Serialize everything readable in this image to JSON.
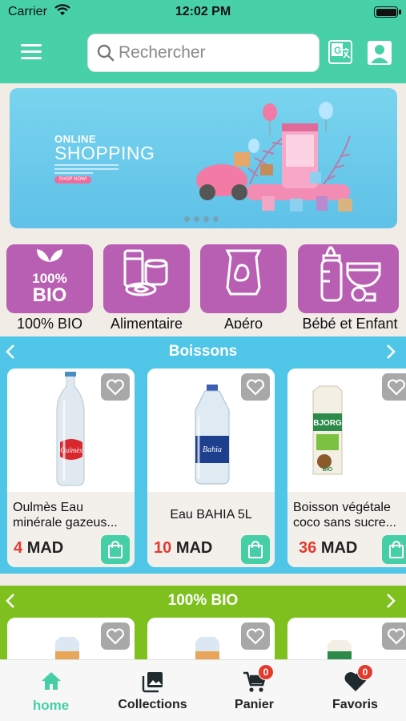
{
  "status_bar": {
    "carrier": "Carrier",
    "time": "12:02 PM"
  },
  "header": {
    "search_placeholder": "Rechercher",
    "icons": [
      "menu-icon",
      "search-icon",
      "translate-icon",
      "profile-icon"
    ]
  },
  "banner": {
    "line1": "ONLINE",
    "line2": "SHOPPING",
    "cta": "SHOP NOW!",
    "slide_count": 4,
    "active_slide": 1
  },
  "categories": [
    {
      "label": "100% BIO",
      "icon": "bio-leaf-icon"
    },
    {
      "label": "Alimentaire",
      "icon": "canned-food-icon"
    },
    {
      "label": "Apéro",
      "icon": "snack-bag-icon"
    },
    {
      "label": "Bébé et Enfant",
      "icon": "baby-bottle-icon"
    }
  ],
  "sections": [
    {
      "title": "Boissons",
      "color": "#4fc6e8",
      "products": [
        {
          "name": "Oulmès Eau minérale gazeus...",
          "price": "4",
          "currency": "MAD"
        },
        {
          "name": "Eau BAHIA 5L",
          "price": "10",
          "currency": "MAD"
        },
        {
          "name": "Boisson végétale coco sans sucre...",
          "price": "36",
          "currency": "MAD"
        }
      ]
    },
    {
      "title": "100% BIO",
      "color": "#7ec11e",
      "products": [
        {},
        {},
        {}
      ]
    }
  ],
  "bottom_nav": [
    {
      "label": "home",
      "icon": "home-icon",
      "active": true
    },
    {
      "label": "Collections",
      "icon": "collections-icon"
    },
    {
      "label": "Panier",
      "icon": "cart-icon",
      "badge": "0"
    },
    {
      "label": "Favoris",
      "icon": "heart-icon",
      "badge": "0"
    }
  ],
  "colors": {
    "brand": "#48d0a8",
    "price": "#e23b2e",
    "category": "#b95fb3"
  }
}
